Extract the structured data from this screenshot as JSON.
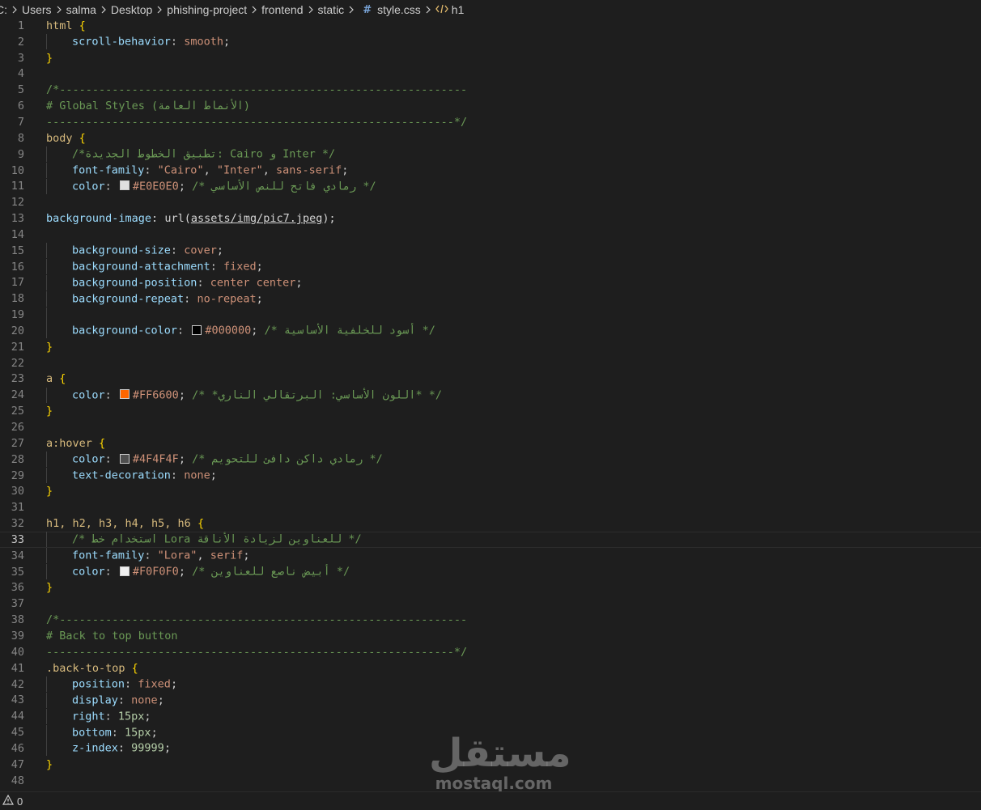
{
  "breadcrumb": {
    "items": [
      "C:",
      "Users",
      "salma",
      "Desktop",
      "phishing-project",
      "frontend",
      "static"
    ],
    "file": "style.css",
    "symbol": "h1"
  },
  "editor": {
    "active_line": 33,
    "lines": [
      {
        "n": "1"
      },
      {
        "n": "2"
      },
      {
        "n": "3"
      },
      {
        "n": "4"
      },
      {
        "n": "5"
      },
      {
        "n": "6"
      },
      {
        "n": "7"
      },
      {
        "n": "8"
      },
      {
        "n": "9"
      },
      {
        "n": "10"
      },
      {
        "n": "11"
      },
      {
        "n": "12"
      },
      {
        "n": "13"
      },
      {
        "n": "14"
      },
      {
        "n": "15"
      },
      {
        "n": "16"
      },
      {
        "n": "17"
      },
      {
        "n": "18"
      },
      {
        "n": "19"
      },
      {
        "n": "20"
      },
      {
        "n": "21"
      },
      {
        "n": "22"
      },
      {
        "n": "23"
      },
      {
        "n": "24"
      },
      {
        "n": "25"
      },
      {
        "n": "26"
      },
      {
        "n": "27"
      },
      {
        "n": "28"
      },
      {
        "n": "29"
      },
      {
        "n": "30"
      },
      {
        "n": "31"
      },
      {
        "n": "32"
      },
      {
        "n": "33"
      },
      {
        "n": "34"
      },
      {
        "n": "35"
      },
      {
        "n": "36"
      },
      {
        "n": "37"
      },
      {
        "n": "38"
      },
      {
        "n": "39"
      },
      {
        "n": "40"
      },
      {
        "n": "41"
      },
      {
        "n": "42"
      },
      {
        "n": "43"
      },
      {
        "n": "44"
      },
      {
        "n": "45"
      },
      {
        "n": "46"
      },
      {
        "n": "47"
      },
      {
        "n": "48"
      }
    ],
    "tokens": {
      "l1_sel": "html",
      "l1_br": " {",
      "l2_prop": "scroll-behavior",
      "l2_colon": ": ",
      "l2_val": "smooth",
      "l2_semi": ";",
      "l3_br": "}",
      "l5_cm": "/*--------------------------------------------------------------",
      "l6_cm": "# Global Styles (الأنماط العامة)",
      "l7_cm": "--------------------------------------------------------------*/",
      "l8_sel": "body",
      "l8_br": " {",
      "l9_cm": "/*تطبيق الخطوط الجديدة: Cairo و Inter */",
      "l10_prop": "font-family",
      "l10_colon": ": ",
      "l10_val1": "\"Cairo\"",
      "l10_comma1": ", ",
      "l10_val2": "\"Inter\"",
      "l10_comma2": ", ",
      "l10_val3": "sans-serif",
      "l10_semi": ";",
      "l11_prop": "color",
      "l11_colon": ": ",
      "l11_val": "#E0E0E0",
      "l11_semi": "; ",
      "l11_cm": "/* رمادي فاتح للنص الأساسي */",
      "l13_prop": "background-image",
      "l13_colon": ": ",
      "l13_fn": "url(",
      "l13_url": "assets/img/pic7.jpeg",
      "l13_close": ");",
      "l15_prop": "background-size",
      "l15_colon": ": ",
      "l15_val": "cover",
      "l15_semi": ";",
      "l16_prop": "background-attachment",
      "l16_colon": ": ",
      "l16_val": "fixed",
      "l16_semi": ";",
      "l17_prop": "background-position",
      "l17_colon": ": ",
      "l17_val": "center center",
      "l17_semi": ";",
      "l18_prop": "background-repeat",
      "l18_colon": ": ",
      "l18_val": "no-repeat",
      "l18_semi": ";",
      "l20_prop": "background-color",
      "l20_colon": ": ",
      "l20_val": "#000000",
      "l20_semi": "; ",
      "l20_cm": "/* أسود للخلفية الأساسية */",
      "l21_br": "}",
      "l23_sel": "a",
      "l23_br": " {",
      "l24_prop": "color",
      "l24_colon": ": ",
      "l24_val": "#FF6600",
      "l24_semi": "; ",
      "l24_cm": "/* *اللون الأساسي: البرتقالي الناري* */",
      "l25_br": "}",
      "l27_sel": "a:hover",
      "l27_br": " {",
      "l28_prop": "color",
      "l28_colon": ": ",
      "l28_val": "#4F4F4F",
      "l28_semi": "; ",
      "l28_cm": "/* رمادي داكن دافئ للتحويم */",
      "l29_prop": "text-decoration",
      "l29_colon": ": ",
      "l29_val": "none",
      "l29_semi": ";",
      "l30_br": "}",
      "l32_sel": "h1, h2, h3, h4, h5, h6",
      "l32_br": " {",
      "l33_cm": "/* استخدام خط Lora للعناوين لزيادة الأناقة */",
      "l34_prop": "font-family",
      "l34_colon": ": ",
      "l34_val": "\"Lora\"",
      "l34_comma": ", ",
      "l34_val2": "serif",
      "l34_semi": ";",
      "l35_prop": "color",
      "l35_colon": ": ",
      "l35_val": "#F0F0F0",
      "l35_semi": "; ",
      "l35_cm": "/* أبيض ناصع للعناوين */",
      "l36_br": "}",
      "l38_cm": "/*--------------------------------------------------------------",
      "l39_cm": "# Back to top button",
      "l40_cm": "--------------------------------------------------------------*/",
      "l41_sel": ".back-to-top",
      "l41_br": " {",
      "l42_prop": "position",
      "l42_colon": ": ",
      "l42_val": "fixed",
      "l42_semi": ";",
      "l43_prop": "display",
      "l43_colon": ": ",
      "l43_val": "none",
      "l43_semi": ";",
      "l44_prop": "right",
      "l44_colon": ": ",
      "l44_num": "15px",
      "l44_semi": ";",
      "l45_prop": "bottom",
      "l45_colon": ": ",
      "l45_num": "15px",
      "l45_semi": ";",
      "l46_prop": "z-index",
      "l46_colon": ": ",
      "l46_num": "99999",
      "l46_semi": ";",
      "l47_br": "}"
    },
    "swatches": {
      "l11": "#E0E0E0",
      "l20": "#000000",
      "l24": "#FF6600",
      "l28": "#4F4F4F",
      "l35": "#F0F0F0"
    }
  },
  "statusbar": {
    "warnings_icon": "warning-icon",
    "warnings_count": "0"
  },
  "watermark": {
    "arabic": "مستقل",
    "latin": "mostaql.com"
  },
  "colors": {
    "background": "#1e1e1e",
    "selector": "#d7ba7d",
    "property": "#9cdcfe",
    "value": "#ce9178",
    "number": "#b5cea8",
    "comment": "#6a9955",
    "bracket": "#ffd700"
  }
}
